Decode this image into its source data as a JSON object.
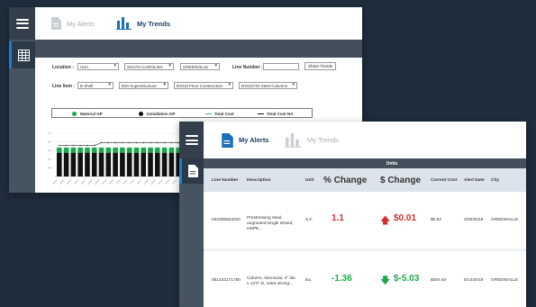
{
  "colors": {
    "rail": "#465462",
    "band": "#454f5b",
    "accent": "#1a7fd6",
    "green": "#1fa84b",
    "red": "#d32f2f",
    "black": "#111111",
    "gray": "#999999"
  },
  "back_window": {
    "tabs": [
      {
        "label": "My Alerts",
        "icon": "document-icon",
        "active": false
      },
      {
        "label": "My Trends",
        "icon": "bar-chart-icon",
        "active": true
      }
    ],
    "filters": {
      "location_label": "Location :",
      "location_values": [
        "USA",
        "SOUTH CAROLINA",
        "GREENVILLE"
      ],
      "line_number_label": "Line Number :",
      "line_number_value": "",
      "share_label": "Share Trends",
      "line_item_label": "Line Item :",
      "line_item_values": [
        "B Shell",
        "B10 Superstructure",
        "B1010 Floor Construction",
        "B1010720 Steel Columns"
      ]
    },
    "legend": [
      "Material OP",
      "Installation OP",
      "Total Cost",
      "Total Cost NA"
    ]
  },
  "chart_data": {
    "type": "bar",
    "series": [
      {
        "name": "Material OP",
        "color": "#1fa84b"
      },
      {
        "name": "Installation OP",
        "color": "#111111"
      },
      {
        "name": "Total Cost",
        "color": "#4aa3df"
      },
      {
        "name": "Total Cost NA",
        "color": "#111111"
      }
    ],
    "bar_count": 42,
    "installation_level": 0.55,
    "material_level": 0.12,
    "total_cost_level": 0.78
  },
  "front_window": {
    "tabs": [
      {
        "label": "My Alerts",
        "icon": "document-icon",
        "active": true
      },
      {
        "label": "My Trends",
        "icon": "bar-chart-icon",
        "active": false
      }
    ],
    "units_label": "Units",
    "columns": [
      "Line Number",
      "Description",
      "Unit",
      "% Change",
      "$ Change",
      "Current Cost",
      "Alert Date",
      "City"
    ],
    "rows": [
      {
        "line_number": "032305503200",
        "description": "Prestressing steel, ungrouted single strand, HDPE...",
        "unit": "S.F.",
        "pct_change": "1.1",
        "usd_change": "$0.01",
        "direction": "up",
        "current_cost": "$0.92",
        "alert_date": "3/30/2018",
        "city": "GREENVILLE"
      },
      {
        "line_number": "051223171750",
        "description": "Column, structural, 4\" dia x 12'0\" D, extra strong...",
        "unit": "Ea.",
        "pct_change": "-1.36",
        "usd_change": "$-5.03",
        "direction": "down",
        "current_cost": "$364.64",
        "alert_date": "5/14/2018",
        "city": "GREENVILLE"
      }
    ]
  }
}
